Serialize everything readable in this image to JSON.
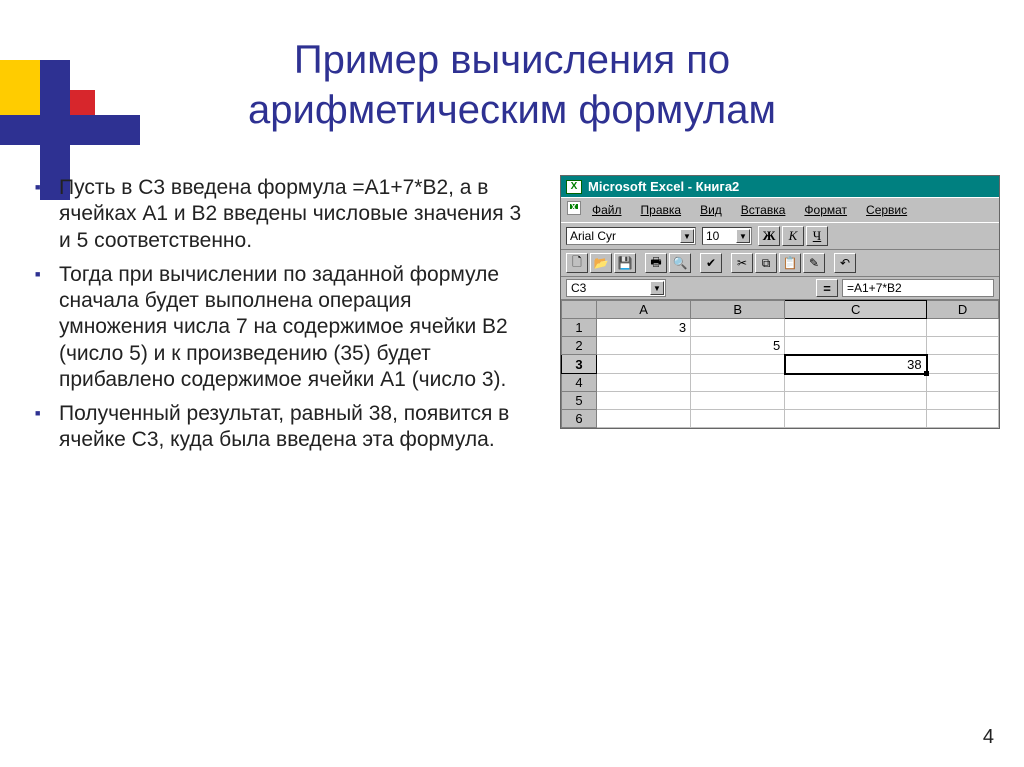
{
  "title_line1": "Пример вычисления по",
  "title_line2": "арифметическим формулам",
  "bullets": [
    "Пусть в С3 введена формула =А1+7*В2, а в ячейках А1 и В2 введены числовые значения 3 и 5 соответственно.",
    "Тогда при вычислении по заданной формуле сначала будет выполнена операция умножения числа 7 на содержимое ячейки В2 (число 5) и к произведению (35) будет прибавлено содержимое ячейки А1 (число 3).",
    "Полученный результат, равный 38, появится в ячейке С3, куда была введена эта формула."
  ],
  "excel": {
    "app_title": "Microsoft Excel - Книга2",
    "menu": [
      "Файл",
      "Правка",
      "Вид",
      "Вставка",
      "Формат",
      "Сервис"
    ],
    "font_name": "Arial Cyr",
    "font_size": "10",
    "bold": "Ж",
    "italic": "К",
    "underline": "Ч",
    "name_box": "C3",
    "formula": "=A1+7*B2",
    "columns": [
      "A",
      "B",
      "C",
      "D"
    ],
    "rows": [
      "1",
      "2",
      "3",
      "4",
      "5",
      "6"
    ],
    "cells": {
      "A1": "3",
      "B2": "5",
      "C3": "38"
    },
    "active_col": "C",
    "active_row": "3"
  },
  "page_number": "4"
}
